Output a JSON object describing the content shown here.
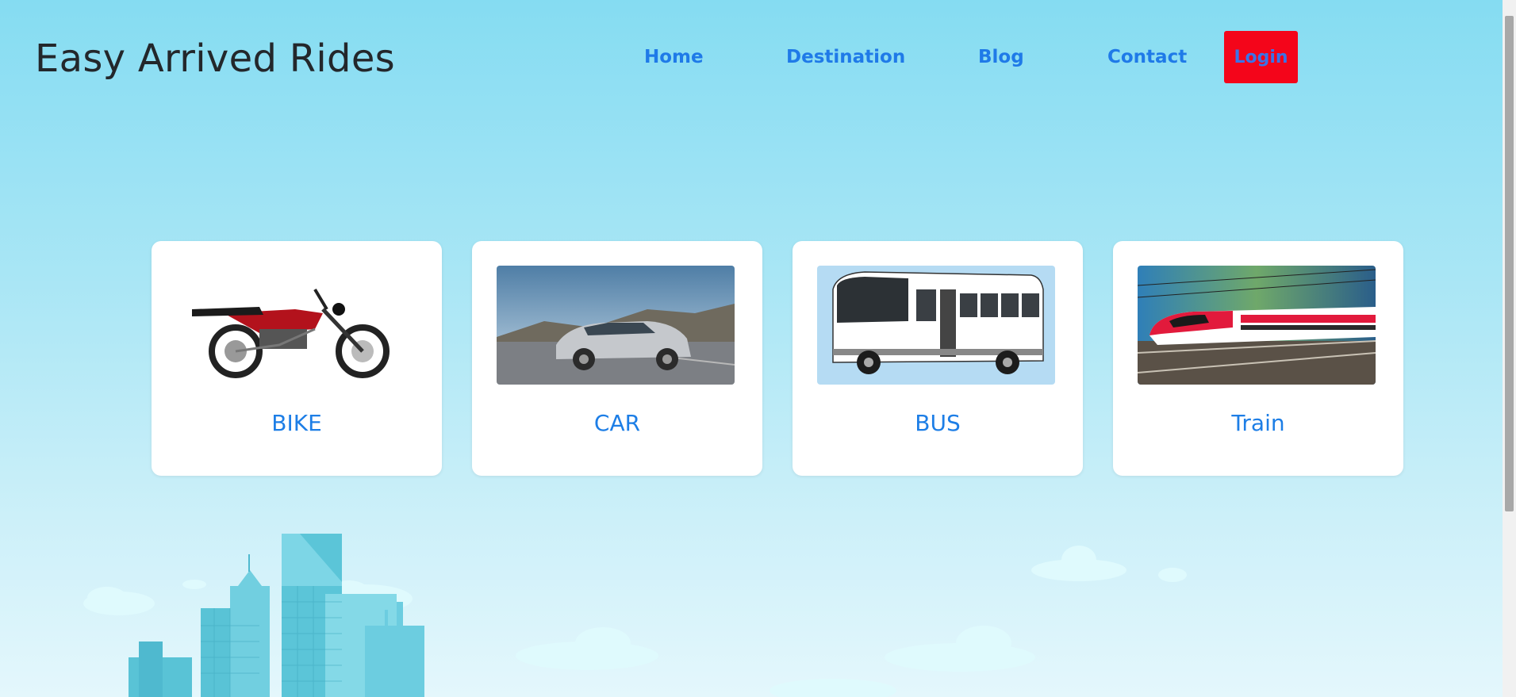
{
  "header": {
    "brand": "Easy Arrived Rides"
  },
  "nav": {
    "items": [
      {
        "label": "Home"
      },
      {
        "label": "Destination"
      },
      {
        "label": "Blog"
      },
      {
        "label": "Contact"
      }
    ],
    "login_label": "Login"
  },
  "cards": [
    {
      "label": "BIKE",
      "icon": "motorcycle-image"
    },
    {
      "label": "CAR",
      "icon": "car-image"
    },
    {
      "label": "BUS",
      "icon": "bus-image"
    },
    {
      "label": "Train",
      "icon": "train-image"
    }
  ],
  "colors": {
    "accent": "#1f7ae8",
    "login_bg": "#f4051a",
    "card_bg": "#ffffff"
  }
}
